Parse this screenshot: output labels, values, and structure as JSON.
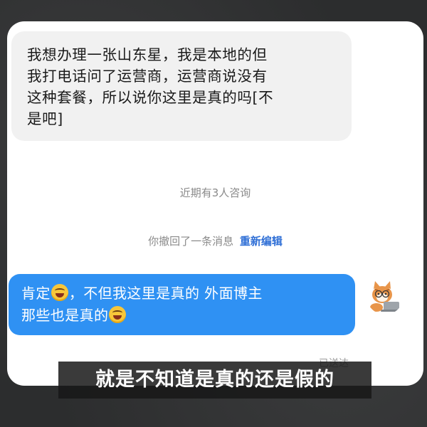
{
  "messages": {
    "incoming": {
      "line1": "我想办理一张山东星，我是本地的但",
      "line2": "我打电话问了运营商，运营商说没有",
      "line3": "这种套餐，所以说你这里是真的吗[不",
      "line4": "是吧]"
    },
    "consult_notice": "近期有3人咨询",
    "recall_notice": "你撤回了一条消息",
    "recall_action": "重新编辑",
    "outgoing": {
      "part1": "肯定",
      "part2": "，不但我这里是真的 外面博主",
      "part3": "那些也是真的",
      "emoji": "laughing-tears-icon"
    },
    "status": "已送达"
  },
  "caption": "就是不知道是真的还是假的",
  "colors": {
    "outgoing_bubble": "#2f91f3",
    "incoming_bubble": "#f1f1f1",
    "reedit_link": "#2f6fd6"
  }
}
